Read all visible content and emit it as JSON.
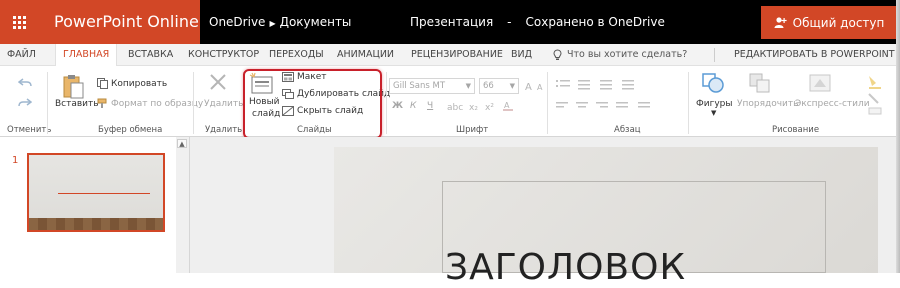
{
  "app": {
    "name": "PowerPoint Online",
    "breadcrumb": [
      "OneDrive",
      "Документы"
    ],
    "doc_title": "Презентация",
    "save_status": "Сохранено в OneDrive",
    "share_label": "Общий доступ",
    "brand_color": "#d24726"
  },
  "tabs": [
    {
      "label": "ФАЙЛ"
    },
    {
      "label": "ГЛАВНАЯ",
      "active": true
    },
    {
      "label": "ВСТАВКА"
    },
    {
      "label": "КОНСТРУКТОР"
    },
    {
      "label": "ПЕРЕХОДЫ"
    },
    {
      "label": "АНИМАЦИИ"
    },
    {
      "label": "РЕЦЕНЗИРОВАНИЕ"
    },
    {
      "label": "ВИД"
    }
  ],
  "tell_me": "Что вы хотите сделать?",
  "edit_in_app": "РЕДАКТИРОВАТЬ В POWERPOINT",
  "ribbon": {
    "undo_group": "Отменить",
    "clipboard": {
      "label": "Буфер обмена",
      "paste": "Вставить",
      "copy": "Копировать",
      "format_painter": "Формат по образцу"
    },
    "delete": {
      "label": "Удалить",
      "button": "Удалить"
    },
    "slides": {
      "label": "Слайды",
      "new_slide_line1": "Новый",
      "new_slide_line2": "слайд",
      "layout": "Макет",
      "duplicate": "Дублировать слайд",
      "hide": "Скрыть слайд"
    },
    "font": {
      "label": "Шрифт",
      "family": "Gill Sans MT",
      "size": "66",
      "bold": "Ж",
      "italic": "К",
      "underline": "Ч"
    },
    "paragraph": {
      "label": "Абзац"
    },
    "drawing": {
      "label": "Рисование",
      "shapes": "Фигуры",
      "arrange": "Упорядочить",
      "quick_styles": "Экспресс-стили"
    }
  },
  "thumbnails": [
    {
      "number": "1"
    }
  ],
  "slide": {
    "title": "ЗАГОЛОВОК"
  }
}
